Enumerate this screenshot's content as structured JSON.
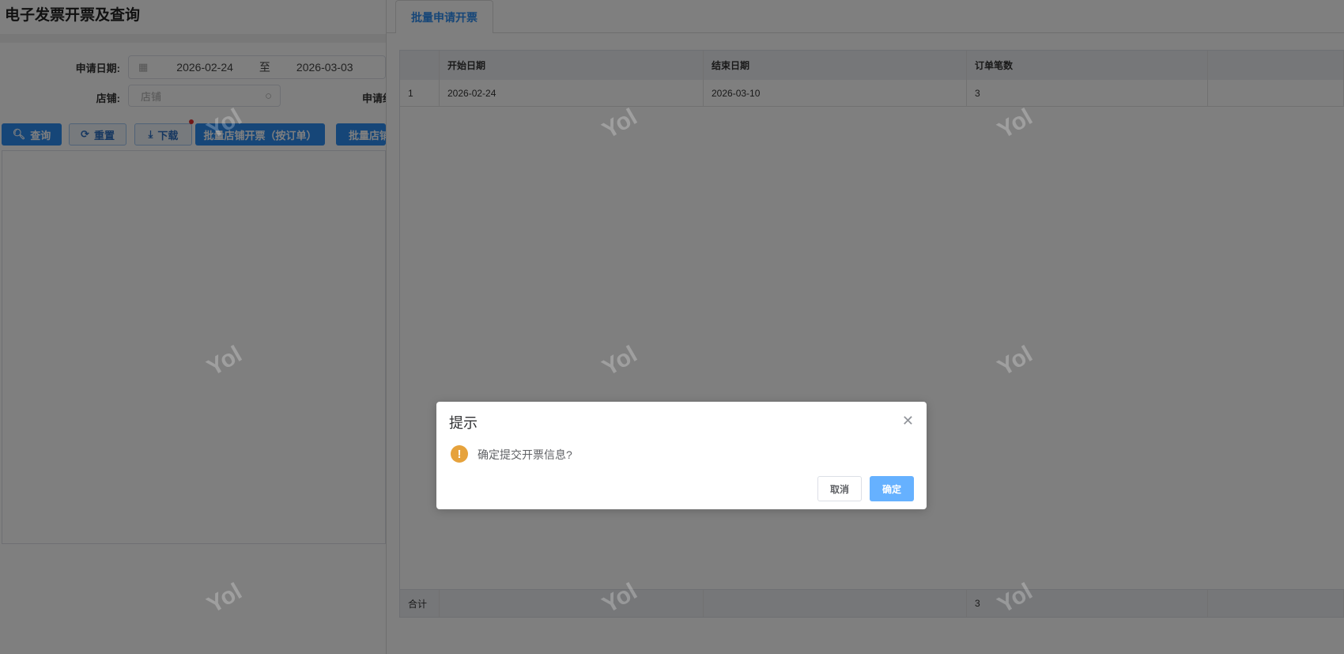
{
  "page": {
    "title": "电子发票开票及查询"
  },
  "filters": {
    "apply_date_label": "申请日期:",
    "date_start": "2026-02-24",
    "date_sep": "至",
    "date_end": "2026-03-03",
    "store_label": "店铺:",
    "store_placeholder": "店铺",
    "apply_partial_label": "申请约"
  },
  "toolbar": {
    "query": "查询",
    "reset": "重置",
    "download": "下载",
    "batch_store_invoice_by_order": "批量店铺开票（按订单）",
    "batch_store_partial": "批量店铺"
  },
  "drawer": {
    "tab": "批量申请开票",
    "table": {
      "headers": [
        "",
        "开始日期",
        "结束日期",
        "订单笔数",
        ""
      ],
      "rows": [
        [
          "1",
          "2026-02-24",
          "2026-03-10",
          "3",
          ""
        ]
      ],
      "footer": [
        "合计",
        "",
        "",
        "3",
        ""
      ]
    }
  },
  "watermark": "Yol",
  "dialog": {
    "title": "提示",
    "message": "确定提交开票信息?",
    "cancel": "取消",
    "confirm": "确定",
    "icon": "warning-icon",
    "warning_color": "#e6a23c",
    "confirm_color": "#66b1ff"
  }
}
